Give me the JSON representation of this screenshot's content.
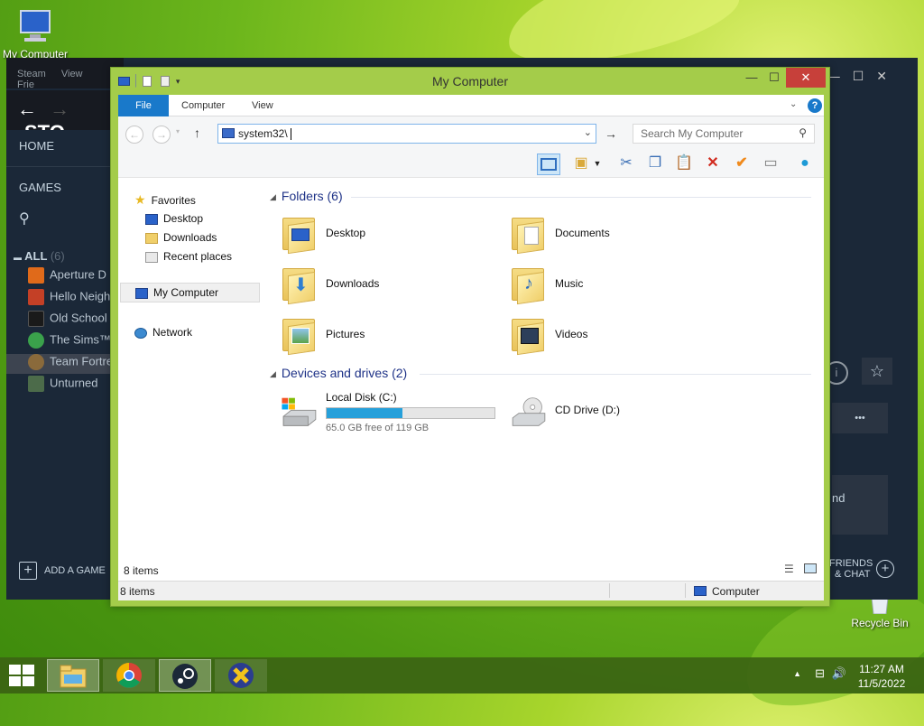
{
  "desktop": {
    "icons": [
      {
        "name": "my-computer-desktop-icon",
        "label": "My Computer"
      },
      {
        "name": "recycle-bin-desktop-icon",
        "label": "Recycle Bin"
      }
    ]
  },
  "steam": {
    "menu": [
      "Steam",
      "View",
      "Frie"
    ],
    "store_label": "STO",
    "home": "HOME",
    "games": "GAMES",
    "all_label": "ALL",
    "all_count": "(6)",
    "games_list": [
      {
        "label": "Aperture D",
        "color": "#e06a1a"
      },
      {
        "label": "Hello Neigh",
        "color": "#c44026"
      },
      {
        "label": "Old School",
        "color": "#1a1a1a"
      },
      {
        "label": "The Sims™",
        "color": "#3aa14b"
      },
      {
        "label": "Team Fortre",
        "color": "#8a6a3b"
      },
      {
        "label": "Unturned",
        "color": "#4c6b4a"
      }
    ],
    "add_game": "ADD A GAME",
    "friends": "FRIENDS",
    "chat": "& CHAT",
    "right_partial": "nd",
    "dots": "•••"
  },
  "explorer": {
    "title": "My Computer",
    "tabs": {
      "file": "File",
      "computer": "Computer",
      "view": "View"
    },
    "address": "system32\\",
    "search_placeholder": "Search My Computer",
    "nav": {
      "favorites": "Favorites",
      "desktop": "Desktop",
      "downloads": "Downloads",
      "recent": "Recent places",
      "my_computer": "My Computer",
      "network": "Network"
    },
    "folders_header": "Folders (6)",
    "folders": [
      {
        "label": "Desktop",
        "overlay": ""
      },
      {
        "label": "Documents",
        "overlay": "doc"
      },
      {
        "label": "Downloads",
        "overlay": "down"
      },
      {
        "label": "Music",
        "overlay": "music"
      },
      {
        "label": "Pictures",
        "overlay": "pic"
      },
      {
        "label": "Videos",
        "overlay": "video"
      }
    ],
    "devices_header": "Devices and drives (2)",
    "drives": [
      {
        "label": "Local Disk (C:)",
        "free_text": "65.0 GB free of 119 GB",
        "used_fraction": 0.454
      },
      {
        "label": "CD Drive (D:)"
      }
    ],
    "status_items": "8 items",
    "status_items_bottom": "8 items",
    "status_location": "Computer"
  },
  "taskbar": {
    "time": "11:27 AM",
    "date": "11/5/2022"
  }
}
